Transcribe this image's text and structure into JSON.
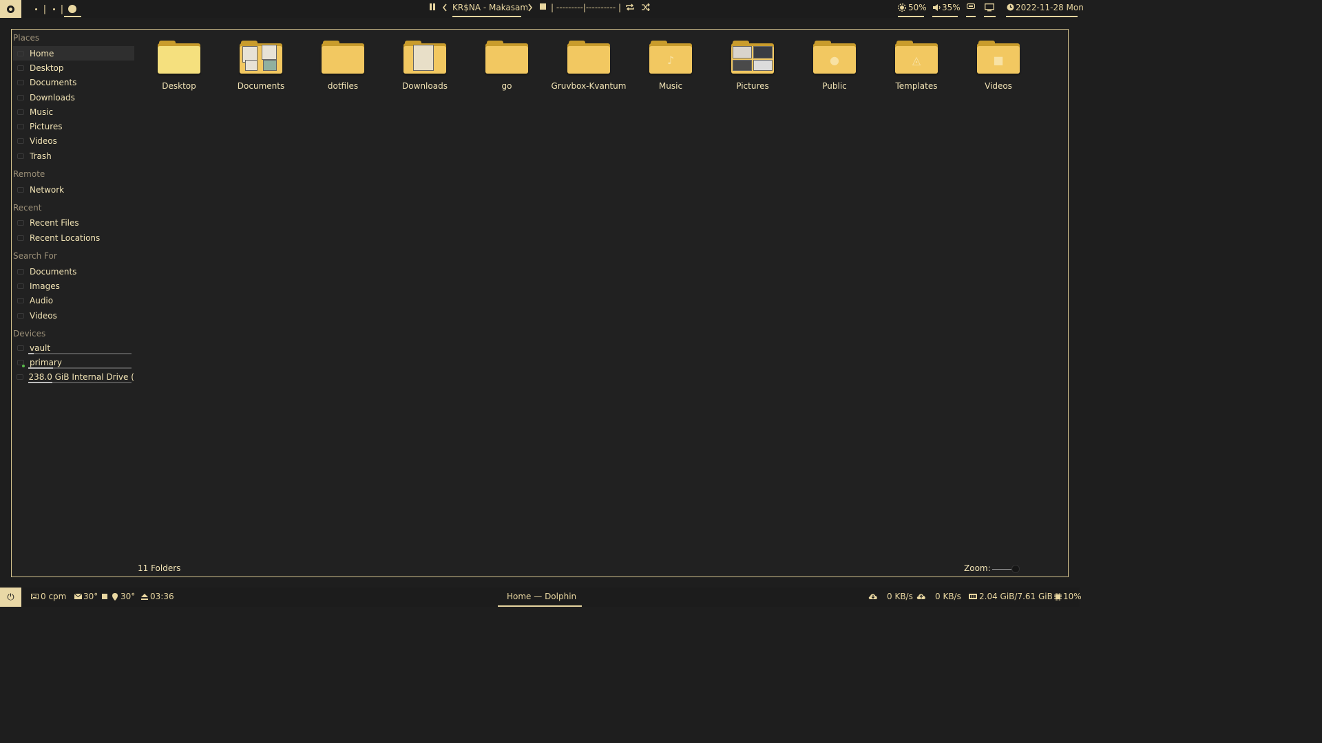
{
  "topbar": {
    "media": {
      "track": "KR$NA - Makasam",
      "progress_text": "| ---------|---------- |"
    },
    "brightness": "50%",
    "volume": "35%",
    "datetime": "2022-11-28 Mon"
  },
  "sidebar": {
    "sections": {
      "places": "Places",
      "remote": "Remote",
      "recent": "Recent",
      "search": "Search For",
      "devices": "Devices"
    },
    "places": [
      "Home",
      "Desktop",
      "Documents",
      "Downloads",
      "Music",
      "Pictures",
      "Videos",
      "Trash"
    ],
    "remote": [
      "Network"
    ],
    "recent": [
      "Recent Files",
      "Recent Locations"
    ],
    "search": [
      "Documents",
      "Images",
      "Audio",
      "Videos"
    ],
    "devices": [
      {
        "label": "vault",
        "usage": 0.05
      },
      {
        "label": "primary",
        "usage": 0.24
      },
      {
        "label": "238.0 GiB Internal Drive (...",
        "usage": 0.23
      }
    ]
  },
  "folders": [
    "Desktop",
    "Documents",
    "dotfiles",
    "Downloads",
    "go",
    "Gruvbox-Kvantum",
    "Music",
    "Pictures",
    "Public",
    "Templates",
    "Videos"
  ],
  "status": {
    "count": "11 Folders",
    "zoom_label": "Zoom:"
  },
  "bottombar": {
    "cpm": "0 cpm",
    "temp1": "30°",
    "temp2": "30°",
    "uptime": "03:36",
    "window_title": "Home — Dolphin",
    "net_down": "0 KB/s",
    "net_up": "0 KB/s",
    "memory": "2.04 GiB/7.61 GiB",
    "cpu": "10%"
  },
  "colors": {
    "accent": "#e9d8a6",
    "folder": "#f2c861",
    "background": "#212121"
  }
}
